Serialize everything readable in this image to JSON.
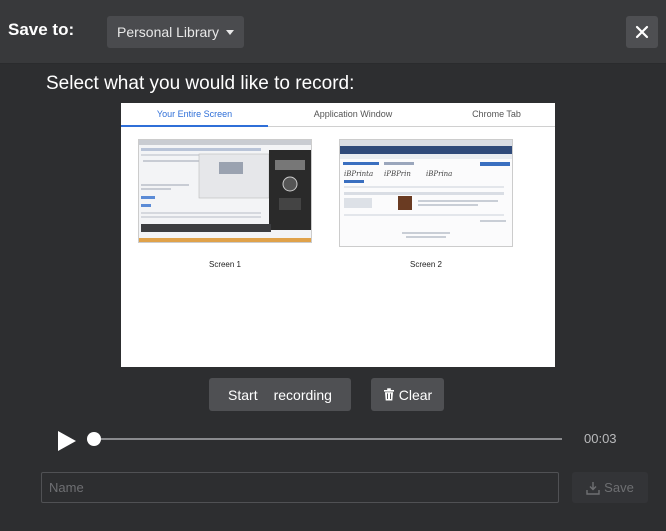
{
  "header": {
    "save_to_label": "Save to:",
    "library_value": "Personal Library",
    "close_glyph": "✕"
  },
  "prompt": "Select what you would like to record:",
  "picker": {
    "tabs": [
      "Your Entire Screen",
      "Application Window",
      "Chrome Tab"
    ],
    "active_tab": "Your Entire Screen",
    "screens": [
      "Screen 1",
      "Screen 2"
    ]
  },
  "controls": {
    "start_label_1": "Start",
    "start_label_2": "recording",
    "clear_label": "Clear"
  },
  "player": {
    "time": "00:03",
    "progress": 0.0
  },
  "footer": {
    "name_placeholder": "Name",
    "save_label": "Save"
  },
  "colors": {
    "background": "#2d2e30",
    "header": "#38393b",
    "button": "#4f5053",
    "accent_tab": "#2f6fd8"
  }
}
